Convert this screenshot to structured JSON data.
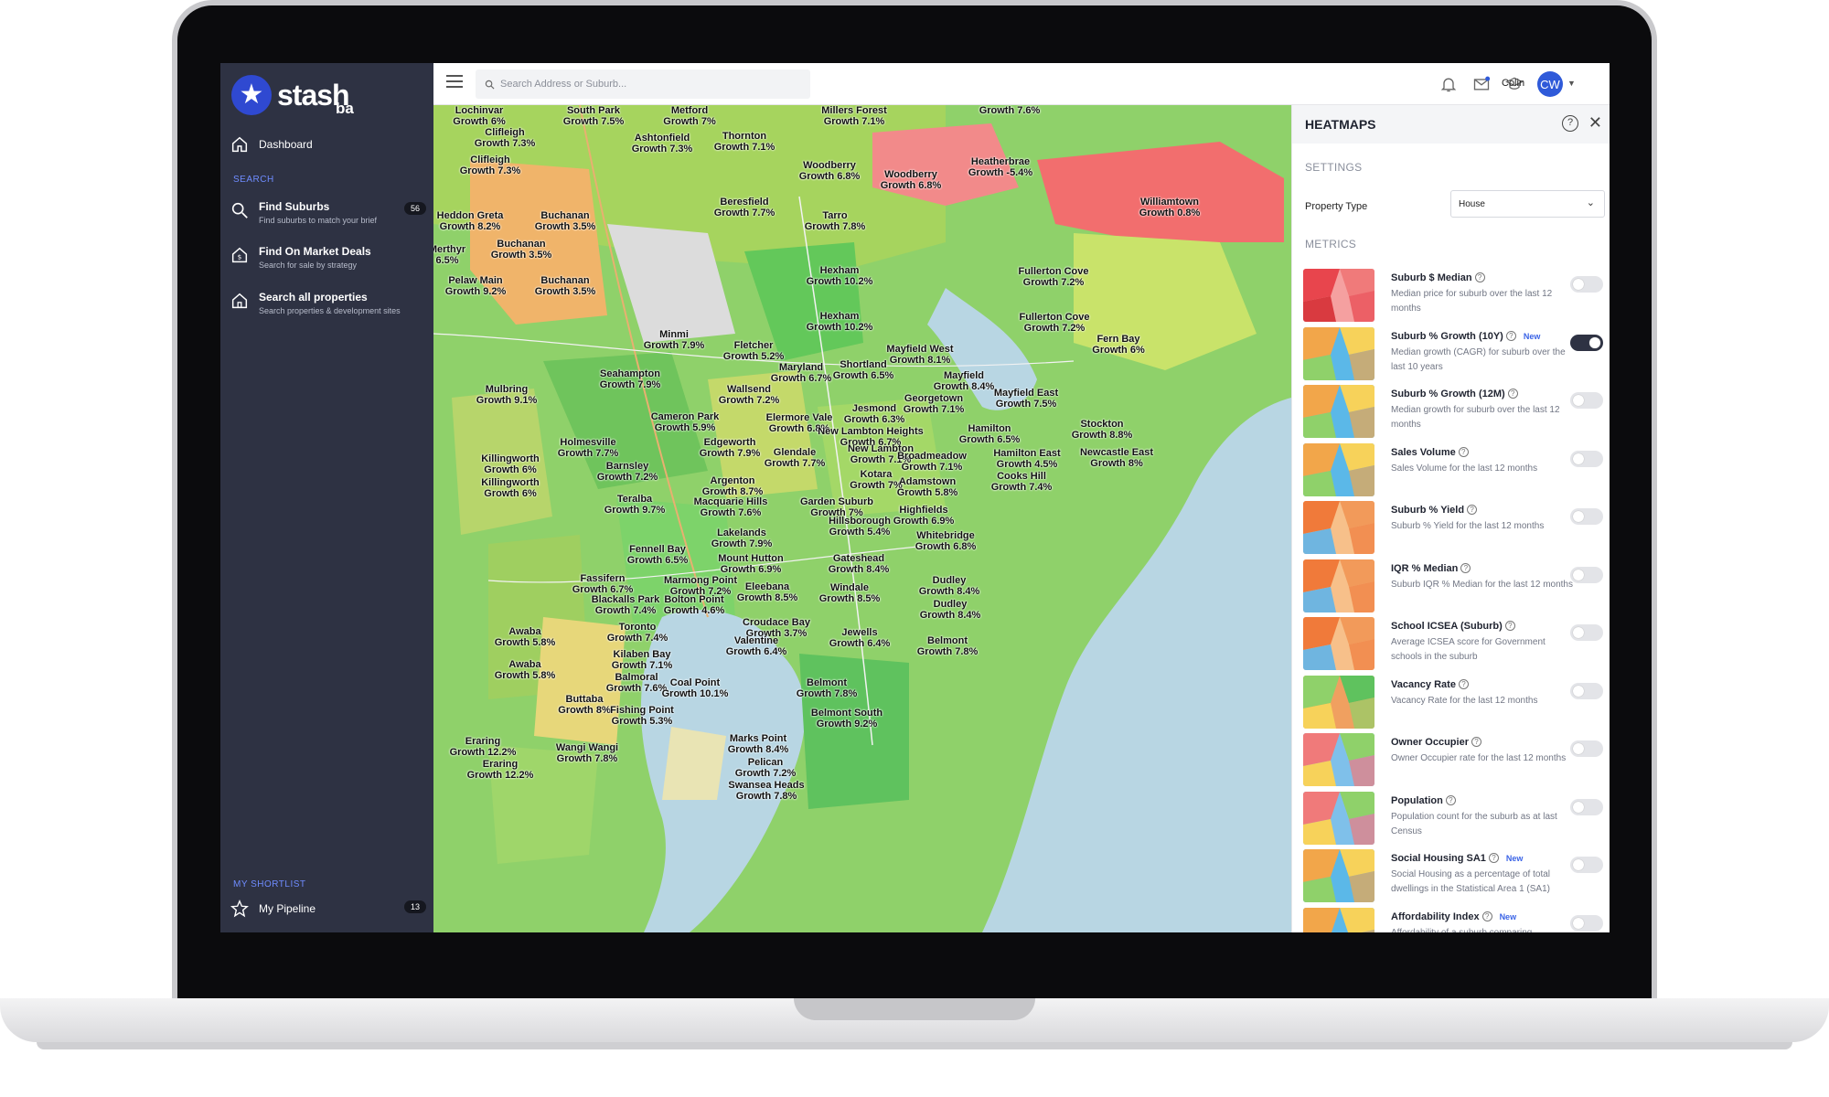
{
  "brand": {
    "name": "stash",
    "sub": "ba"
  },
  "sidebar": {
    "dashboard": "Dashboard",
    "search_section": "SEARCH",
    "items": [
      {
        "title": "Find Suburbs",
        "sub": "Find suburbs to match your brief",
        "badge": "56"
      },
      {
        "title": "Find On Market Deals",
        "sub": "Search for sale by strategy"
      },
      {
        "title": "Search all properties",
        "sub": "Search properties & development sites"
      }
    ],
    "shortlist_section": "MY SHORTLIST",
    "pipeline": {
      "title": "My Pipeline",
      "badge": "13"
    }
  },
  "topbar": {
    "search_placeholder": "Search Address or Suburb...",
    "user_name": "Colin",
    "user_initials": "CW"
  },
  "map_labels": [
    {
      "name": "Lochinvar",
      "growth": "Growth 6%"
    },
    {
      "name": "South Park",
      "growth": "Growth 7.5%"
    },
    {
      "name": "Metford",
      "growth": "Growth 7%"
    },
    {
      "name": "Millers Forest",
      "growth": "Growth 7.1%"
    },
    {
      "name": "Growth 7.6%",
      "growth": ""
    },
    {
      "name": "Clifleigh",
      "growth": "Growth 7.3%"
    },
    {
      "name": "Ashtonfield",
      "growth": "Growth 7.3%"
    },
    {
      "name": "Thornton",
      "growth": "Growth 7.1%"
    },
    {
      "name": "Heatherbrae",
      "growth": "Growth -5.4%"
    },
    {
      "name": "Clifleigh",
      "growth": "Growth 7.3%"
    },
    {
      "name": "Woodberry",
      "growth": "Growth 6.8%"
    },
    {
      "name": "Woodberry",
      "growth": "Growth 6.8%"
    },
    {
      "name": "Beresfield",
      "growth": "Growth 7.7%"
    },
    {
      "name": "Williamtown",
      "growth": "Growth 0.8%"
    },
    {
      "name": "Heddon Greta",
      "growth": "Growth 8.2%"
    },
    {
      "name": "Buchanan",
      "growth": "Growth 3.5%"
    },
    {
      "name": "Tarro",
      "growth": "Growth 7.8%"
    },
    {
      "name": "Merthyr",
      "growth": "6.5%"
    },
    {
      "name": "Buchanan",
      "growth": "Growth 3.5%"
    },
    {
      "name": "Fullerton Cove",
      "growth": "Growth 7.2%"
    },
    {
      "name": "Hexham",
      "growth": "Growth 10.2%"
    },
    {
      "name": "Pelaw Main",
      "growth": "Growth 9.2%"
    },
    {
      "name": "Buchanan",
      "growth": "Growth 3.5%"
    },
    {
      "name": "Fullerton Cove",
      "growth": "Growth 7.2%"
    },
    {
      "name": "Hexham",
      "growth": "Growth 10.2%"
    },
    {
      "name": "Fern Bay",
      "growth": "Growth 6%"
    },
    {
      "name": "Minmi",
      "growth": "Growth 7.9%"
    },
    {
      "name": "Fletcher",
      "growth": "Growth 5.2%"
    },
    {
      "name": "Mayfield West",
      "growth": "Growth 8.1%"
    },
    {
      "name": "Seahampton",
      "growth": "Growth 7.9%"
    },
    {
      "name": "Maryland",
      "growth": "Growth 6.7%"
    },
    {
      "name": "Shortland",
      "growth": "Growth 6.5%"
    },
    {
      "name": "Mayfield",
      "growth": "Growth 8.4%"
    },
    {
      "name": "Mulbring",
      "growth": "Growth 9.1%"
    },
    {
      "name": "Wallsend",
      "growth": "Growth 7.2%"
    },
    {
      "name": "Georgetown",
      "growth": "Growth 7.1%"
    },
    {
      "name": "Mayfield East",
      "growth": "Growth 7.5%"
    },
    {
      "name": "Jesmond",
      "growth": "Growth 6.3%"
    },
    {
      "name": "Cameron Park",
      "growth": "Growth 5.9%"
    },
    {
      "name": "Elermore Vale",
      "growth": "Growth 6.8%"
    },
    {
      "name": "Stockton",
      "growth": "Growth 8.8%"
    },
    {
      "name": "New Lambton Heights",
      "growth": "Growth 6.7%"
    },
    {
      "name": "Hamilton",
      "growth": "Growth 6.5%"
    },
    {
      "name": "Holmesville",
      "growth": "Growth 7.7%"
    },
    {
      "name": "Killingworth",
      "growth": "Growth 6%"
    },
    {
      "name": "Edgeworth",
      "growth": "Growth 7.9%"
    },
    {
      "name": "New Lambton",
      "growth": "Growth 7.1%"
    },
    {
      "name": "Hamilton East",
      "growth": "Growth 4.5%"
    },
    {
      "name": "Newcastle East",
      "growth": "Growth 8%"
    },
    {
      "name": "Glendale",
      "growth": "Growth 7.7%"
    },
    {
      "name": "Broadmeadow",
      "growth": "Growth 7.1%"
    },
    {
      "name": "Barnsley",
      "growth": "Growth 7.2%"
    },
    {
      "name": "Kotara",
      "growth": "Growth 7%"
    },
    {
      "name": "Cooks Hill",
      "growth": "Growth 7.4%"
    },
    {
      "name": "Argenton",
      "growth": "Growth 8.7%"
    },
    {
      "name": "Killingworth",
      "growth": "Growth 6%"
    },
    {
      "name": "Adamstown",
      "growth": "Growth 5.8%"
    },
    {
      "name": "Teralba",
      "growth": "Growth 9.7%"
    },
    {
      "name": "Macquarie Hills",
      "growth": "Growth 7.6%"
    },
    {
      "name": "Garden Suburb",
      "growth": "Growth 7%"
    },
    {
      "name": "Highfields",
      "growth": "Growth 6.9%"
    },
    {
      "name": "Hillsborough",
      "growth": "Growth 5.4%"
    },
    {
      "name": "Lakelands",
      "growth": "Growth 7.9%"
    },
    {
      "name": "Whitebridge",
      "growth": "Growth 6.8%"
    },
    {
      "name": "Fennell Bay",
      "growth": "Growth 6.5%"
    },
    {
      "name": "Mount Hutton",
      "growth": "Growth 6.9%"
    },
    {
      "name": "Gateshead",
      "growth": "Growth 8.4%"
    },
    {
      "name": "Fassifern",
      "growth": "Growth 6.7%"
    },
    {
      "name": "Marmong Point",
      "growth": "Growth 7.2%"
    },
    {
      "name": "Eleebana",
      "growth": "Growth 8.5%"
    },
    {
      "name": "Windale",
      "growth": "Growth 8.5%"
    },
    {
      "name": "Dudley",
      "growth": "Growth 8.4%"
    },
    {
      "name": "Blackalls Park",
      "growth": "Growth 7.4%"
    },
    {
      "name": "Bolton Point",
      "growth": "Growth 4.6%"
    },
    {
      "name": "Dudley",
      "growth": "Growth 8.4%"
    },
    {
      "name": "Croudace Bay",
      "growth": "Growth 3.7%"
    },
    {
      "name": "Toronto",
      "growth": "Growth 7.4%"
    },
    {
      "name": "Awaba",
      "growth": "Growth 5.8%"
    },
    {
      "name": "Jewells",
      "growth": "Growth 6.4%"
    },
    {
      "name": "Valentine",
      "growth": "Growth 6.4%"
    },
    {
      "name": "Belmont",
      "growth": "Growth 7.8%"
    },
    {
      "name": "Kilaben Bay",
      "growth": "Growth 7.1%"
    },
    {
      "name": "Awaba",
      "growth": "Growth 5.8%"
    },
    {
      "name": "Balmoral",
      "growth": "Growth 7.6%"
    },
    {
      "name": "Coal Point",
      "growth": "Growth 10.1%"
    },
    {
      "name": "Belmont",
      "growth": "Growth 7.8%"
    },
    {
      "name": "Buttaba",
      "growth": "Growth 8%"
    },
    {
      "name": "Belmont South",
      "growth": "Growth 9.2%"
    },
    {
      "name": "Fishing Point",
      "growth": "Growth 5.3%"
    },
    {
      "name": "Eraring",
      "growth": "Growth 12.2%"
    },
    {
      "name": "Marks Point",
      "growth": "Growth 8.4%"
    },
    {
      "name": "Wangi Wangi",
      "growth": "Growth 7.8%"
    },
    {
      "name": "Eraring",
      "growth": "Growth 12.2%"
    },
    {
      "name": "Pelican",
      "growth": "Growth 7.2%"
    },
    {
      "name": "Swansea Heads",
      "growth": "Growth 7.8%"
    }
  ],
  "panel": {
    "title": "HEATMAPS",
    "settings_label": "SETTINGS",
    "property_type_label": "Property Type",
    "property_type_value": "House",
    "metrics_label": "METRICS",
    "metrics": [
      {
        "title": "Suburb $ Median",
        "desc": "Median price for suburb over the last 12 months",
        "new": "",
        "on": false,
        "palette": "red"
      },
      {
        "title": "Suburb % Growth (10Y)",
        "desc": "Median growth (CAGR) for suburb over the last 10 years",
        "new": "New",
        "on": true,
        "palette": "mix"
      },
      {
        "title": "Suburb % Growth (12M)",
        "desc": "Median growth for suburb over the last 12 months",
        "new": "",
        "on": false,
        "palette": "mix"
      },
      {
        "title": "Sales Volume",
        "desc": "Sales Volume for the last 12 months",
        "new": "",
        "on": false,
        "palette": "mix"
      },
      {
        "title": "Suburb % Yield",
        "desc": "Suburb % Yield for the last 12 months",
        "new": "",
        "on": false,
        "palette": "orange"
      },
      {
        "title": "IQR % Median",
        "desc": "Suburb IQR % Median for the last 12 months",
        "new": "",
        "on": false,
        "palette": "orange"
      },
      {
        "title": "School ICSEA (Suburb)",
        "desc": "Average ICSEA score for Government schools in the suburb",
        "new": "",
        "on": false,
        "palette": "orange"
      },
      {
        "title": "Vacancy Rate",
        "desc": "Vacancy Rate for the last 12 months",
        "new": "",
        "on": false,
        "palette": "green"
      },
      {
        "title": "Owner Occupier",
        "desc": "Owner Occupier rate for the last 12 months",
        "new": "",
        "on": false,
        "palette": "mix2"
      },
      {
        "title": "Population",
        "desc": "Population count for the suburb as at last Census",
        "new": "",
        "on": false,
        "palette": "mix2"
      },
      {
        "title": "Social Housing SA1",
        "desc": "Social Housing as a percentage of total dwellings in the Statistical Area 1 (SA1)",
        "new": "New",
        "on": false,
        "palette": "mix"
      },
      {
        "title": "Affordability Index",
        "desc": "Affordability of a suburb comparing",
        "new": "New",
        "on": false,
        "palette": "mix"
      }
    ]
  }
}
